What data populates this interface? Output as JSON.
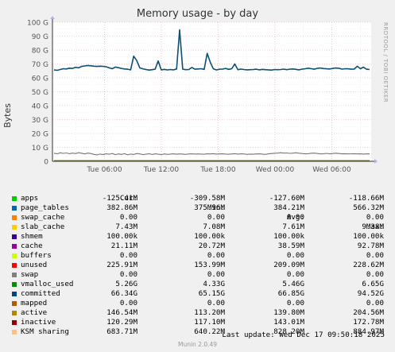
{
  "chart_data": {
    "type": "line",
    "title": "Memory usage - by day",
    "ylabel": "Bytes",
    "ylim": [
      0,
      100
    ],
    "yunit": "G",
    "y_ticks": [
      "0",
      "10 G",
      "20 G",
      "30 G",
      "40 G",
      "50 G",
      "60 G",
      "70 G",
      "80 G",
      "90 G",
      "100 G"
    ],
    "x_ticks": [
      "Tue 06:00",
      "Tue 12:00",
      "Tue 18:00",
      "Wed 00:00",
      "Wed 06:00"
    ],
    "grid": true,
    "series": [
      {
        "name": "committed",
        "color": "#0b4f73",
        "values": [
          65.8,
          65.4,
          66.0,
          66.6,
          66.4,
          67.0,
          66.8,
          67.6,
          67.2,
          68.2,
          68.6,
          68.9,
          68.7,
          68.4,
          68.2,
          68.4,
          68.3,
          68.0,
          67.2,
          66.6,
          67.8,
          67.3,
          66.8,
          66.4,
          66.2,
          65.8,
          75.6,
          72.4,
          67.2,
          66.5,
          66.0,
          65.6,
          65.9,
          66.2,
          72.2,
          65.8,
          66.1,
          65.7,
          66.0,
          65.8,
          66.4,
          94.5,
          66.3,
          65.9,
          66.0,
          67.5,
          66.2,
          66.4,
          66.6,
          66.1,
          77.6,
          71.2,
          66.5,
          65.7,
          66.2,
          66.3,
          66.8,
          66.1,
          66.6,
          70.0,
          65.9,
          66.3,
          66.0,
          65.8,
          65.9,
          66.0,
          66.2,
          65.8,
          66.1,
          65.9,
          65.8,
          65.6,
          66.0,
          65.9,
          66.0,
          66.3,
          65.9,
          66.3,
          66.4,
          66.1,
          65.8,
          66.3,
          66.6,
          67.0,
          66.6,
          66.2,
          66.9,
          67.1,
          66.7,
          66.5,
          66.4,
          66.8,
          67.1,
          66.9,
          66.3,
          66.6,
          66.5,
          66.2,
          66.3,
          68.4,
          66.6,
          67.7,
          66.2,
          66.0
        ]
      },
      {
        "name": "vmalloc_used",
        "color": "#777777",
        "values": [
          5.8,
          5.4,
          6.1,
          5.7,
          6.0,
          5.5,
          5.9,
          5.6,
          6.2,
          5.8,
          5.3,
          5.9,
          5.6,
          5.0,
          4.6,
          5.2,
          4.9,
          5.4,
          5.1,
          5.6,
          4.8,
          5.3,
          5.0,
          5.5,
          4.7,
          5.2,
          4.9,
          5.6,
          5.3,
          4.8,
          5.1,
          5.5,
          4.9,
          5.4,
          5.1,
          4.8,
          5.3,
          5.0,
          5.2,
          5.4,
          5.1,
          5.3,
          5.2,
          5.0,
          5.3,
          5.4,
          5.2,
          5.3,
          5.2,
          5.1,
          5.4,
          5.3,
          5.5,
          5.2,
          5.3,
          5.4,
          5.2,
          5.1,
          5.3,
          5.5,
          5.2,
          5.4,
          5.3,
          5.0,
          5.2,
          5.1,
          5.3,
          5.4,
          5.2,
          5.0,
          5.4,
          5.6,
          5.8,
          5.9,
          6.2,
          5.9,
          6.0,
          5.7,
          5.9,
          6.1,
          5.8,
          5.6,
          5.4,
          5.5,
          5.8,
          5.9,
          5.6,
          5.3,
          5.5,
          5.7,
          5.4,
          5.6,
          5.8,
          5.6,
          5.4,
          5.5,
          5.3,
          5.4,
          5.5,
          5.3,
          5.4,
          5.2,
          5.4,
          5.3
        ]
      },
      {
        "name": "KSM sharing",
        "color": "#ffc080",
        "values": [
          0.68,
          0.68
        ]
      },
      {
        "name": "page_tables",
        "color": "#0066b3",
        "values": [
          0.38,
          0.38
        ]
      },
      {
        "name": "active",
        "color": "#b38800",
        "values": [
          0.15,
          0.15
        ]
      }
    ]
  },
  "legend": {
    "headers": {
      "cur": "Cur:",
      "min": "Min:",
      "avg": "Avg:",
      "max": "Max:"
    },
    "rows": [
      {
        "name": "apps",
        "color": "#00cc00",
        "cur": "-125.41M",
        "min": "-309.58M",
        "avg": "-127.60M",
        "max": "-118.66M"
      },
      {
        "name": "page_tables",
        "color": "#0066b3",
        "cur": "382.86M",
        "min": "375.96M",
        "avg": "384.21M",
        "max": "566.32M"
      },
      {
        "name": "swap_cache",
        "color": "#ff8000",
        "cur": "0.00",
        "min": "0.00",
        "avg": "0.00",
        "max": "0.00"
      },
      {
        "name": "slab_cache",
        "color": "#ffcc00",
        "cur": "7.43M",
        "min": "7.08M",
        "avg": "7.61M",
        "max": "9.38M"
      },
      {
        "name": "shmem",
        "color": "#330099",
        "cur": "100.00k",
        "min": "100.00k",
        "avg": "100.00k",
        "max": "100.00k"
      },
      {
        "name": "cache",
        "color": "#990099",
        "cur": "21.11M",
        "min": "20.72M",
        "avg": "38.59M",
        "max": "92.78M"
      },
      {
        "name": "buffers",
        "color": "#ccff00",
        "cur": "0.00",
        "min": "0.00",
        "avg": "0.00",
        "max": "0.00"
      },
      {
        "name": "unused",
        "color": "#ff0000",
        "cur": "225.91M",
        "min": "153.99M",
        "avg": "209.09M",
        "max": "228.62M"
      },
      {
        "name": "swap",
        "color": "#808080",
        "cur": "0.00",
        "min": "0.00",
        "avg": "0.00",
        "max": "0.00"
      },
      {
        "name": "vmalloc_used",
        "color": "#008f00",
        "cur": "5.26G",
        "min": "4.33G",
        "avg": "5.46G",
        "max": "6.65G"
      },
      {
        "name": "committed",
        "color": "#00487d",
        "cur": "66.34G",
        "min": "65.15G",
        "avg": "66.85G",
        "max": "94.52G"
      },
      {
        "name": "mapped",
        "color": "#b35a00",
        "cur": "0.00",
        "min": "0.00",
        "avg": "0.00",
        "max": "0.00"
      },
      {
        "name": "active",
        "color": "#b38800",
        "cur": "146.54M",
        "min": "113.20M",
        "avg": "139.80M",
        "max": "204.56M"
      },
      {
        "name": "inactive",
        "color": "#960000",
        "cur": "120.29M",
        "min": "117.10M",
        "avg": "143.01M",
        "max": "172.78M"
      },
      {
        "name": "KSM sharing",
        "color": "#ffc080",
        "cur": "683.71M",
        "min": "640.22M",
        "avg": "828.20M",
        "max": "884.97M"
      }
    ]
  },
  "last_update": "Last update: Wed Dec 17 09:50:18 2025",
  "footer": "Munin 2.0.49",
  "side_text": "RRDTOOL / TOBI OETIKER"
}
